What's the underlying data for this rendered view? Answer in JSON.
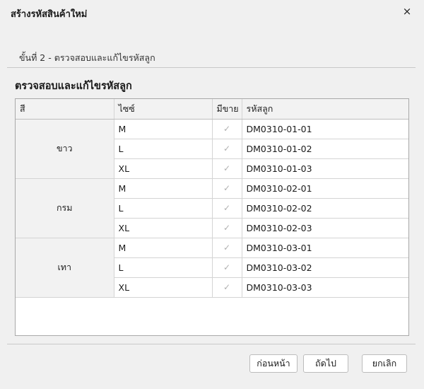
{
  "window": {
    "title": "สร้างรหัสสินค้าใหม่",
    "close_glyph": "×"
  },
  "step_label": "ขั้นที่ 2 - ตรวจสอบและแก้ไขรหัสลูก",
  "section_title": "ตรวจสอบและแก้ไขรหัสลูก",
  "table": {
    "headers": [
      "สี",
      "ไซซ์",
      "มีขาย",
      "รหัสลูก"
    ],
    "groups": [
      {
        "color": "ขาว",
        "rows": [
          {
            "size": "M",
            "available": "✓",
            "code": "DM0310-01-01"
          },
          {
            "size": "L",
            "available": "✓",
            "code": "DM0310-01-02"
          },
          {
            "size": "XL",
            "available": "✓",
            "code": "DM0310-01-03"
          }
        ]
      },
      {
        "color": "กรม",
        "rows": [
          {
            "size": "M",
            "available": "✓",
            "code": "DM0310-02-01"
          },
          {
            "size": "L",
            "available": "✓",
            "code": "DM0310-02-02"
          },
          {
            "size": "XL",
            "available": "✓",
            "code": "DM0310-02-03"
          }
        ]
      },
      {
        "color": "เทา",
        "rows": [
          {
            "size": "M",
            "available": "✓",
            "code": "DM0310-03-01"
          },
          {
            "size": "L",
            "available": "✓",
            "code": "DM0310-03-02"
          },
          {
            "size": "XL",
            "available": "✓",
            "code": "DM0310-03-03"
          }
        ]
      }
    ]
  },
  "buttons": {
    "back": "ก่อนหน้า",
    "next": "ถัดไป",
    "cancel": "ยกเลิก"
  }
}
